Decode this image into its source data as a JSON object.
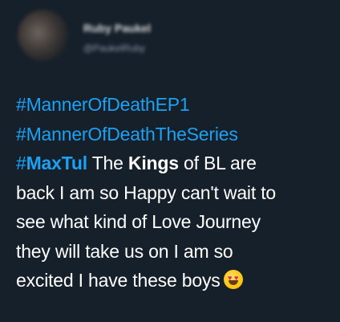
{
  "author": {
    "display_name": "Ruby Paukel",
    "handle": "@PaukelRuby"
  },
  "tweet": {
    "lines": [
      [
        {
          "t": "#MannerOfDeathEP1",
          "s": "hashtag"
        }
      ],
      [
        {
          "t": "#MannerOfDeathTheSeries",
          "s": "hashtag"
        }
      ],
      [
        {
          "t": "#",
          "s": "hashtag"
        },
        {
          "t": "MaxTul",
          "s": "hashtag bold"
        },
        {
          "t": " The ",
          "s": ""
        },
        {
          "t": "Kings",
          "s": "bold"
        },
        {
          "t": " of BL are",
          "s": ""
        }
      ],
      [
        {
          "t": "back I am so Happy can't wait to",
          "s": ""
        }
      ],
      [
        {
          "t": "see what kind of Love Journey",
          "s": ""
        }
      ],
      [
        {
          "t": "they will take us on I am so",
          "s": ""
        }
      ],
      [
        {
          "t": "excited I have these boys",
          "s": ""
        }
      ]
    ],
    "emoji": "heart-eyes-emoji"
  },
  "colors": {
    "background": "#15202b",
    "hashtag": "#1da1f2",
    "text": "#ffffff"
  }
}
